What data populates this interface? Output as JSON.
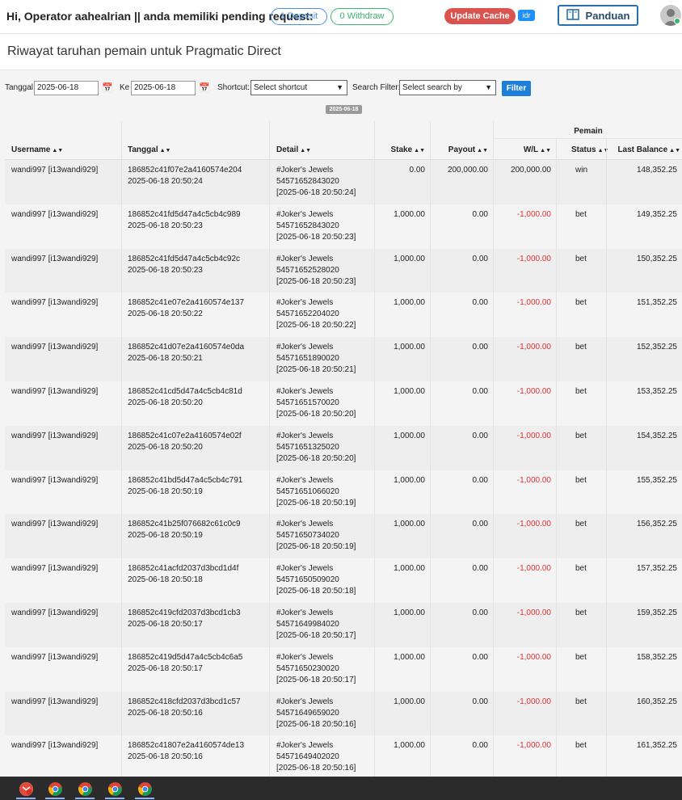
{
  "header": {
    "greeting": "Hi, Operator aahealrian || anda memiliki pending request:",
    "deposit_label": "1 Deposit",
    "withdraw_label": "0 Withdraw",
    "update_cache_label": "Update Cache",
    "currency_badge": "idr",
    "panduan_label": "Panduan",
    "avatar_icon": "user-avatar-icon"
  },
  "page": {
    "title": "Riwayat taruhan pemain untuk Pragmatic Direct"
  },
  "filters": {
    "tanggal_label": "Tanggal",
    "tanggal_value": "2025-06-18",
    "ke_label": "Ke",
    "ke_value": "2025-06-18",
    "shortcut_label": "Shortcut:",
    "shortcut_value": "Select shortcut",
    "search_filter_label": "Search Filter:",
    "search_filter_value": "Select search by",
    "filter_button": "Filter",
    "date_chip": "2025-06-18"
  },
  "table": {
    "group_header": "Pemain",
    "columns": [
      "Username",
      "Tanggal",
      "Detail",
      "Stake",
      "Payout",
      "W/L",
      "Status",
      "Last Balance"
    ],
    "rows": [
      {
        "username": "wandi997 [i13wandi929]",
        "id": "186852c41f07e2a4160574e204",
        "date": "2025-06-18 20:50:24",
        "game": "#Joker's Jewels",
        "round": "54571652843020",
        "ts": "[2025-06-18 20:50:24]",
        "stake": "0.00",
        "payout": "200,000.00",
        "wl": "200,000.00",
        "status": "win",
        "balance": "148,352.25"
      },
      {
        "username": "wandi997 [i13wandi929]",
        "id": "186852c41fd5d47a4c5cb4c989",
        "date": "2025-06-18 20:50:23",
        "game": "#Joker's Jewels",
        "round": "54571652843020",
        "ts": "[2025-06-18 20:50:23]",
        "stake": "1,000.00",
        "payout": "0.00",
        "wl": "-1,000.00",
        "status": "bet",
        "balance": "149,352.25"
      },
      {
        "username": "wandi997 [i13wandi929]",
        "id": "186852c41fd5d47a4c5cb4c92c",
        "date": "2025-06-18 20:50:23",
        "game": "#Joker's Jewels",
        "round": "54571652528020",
        "ts": "[2025-06-18 20:50:23]",
        "stake": "1,000.00",
        "payout": "0.00",
        "wl": "-1,000.00",
        "status": "bet",
        "balance": "150,352.25"
      },
      {
        "username": "wandi997 [i13wandi929]",
        "id": "186852c41e07e2a4160574e137",
        "date": "2025-06-18 20:50:22",
        "game": "#Joker's Jewels",
        "round": "54571652204020",
        "ts": "[2025-06-18 20:50:22]",
        "stake": "1,000.00",
        "payout": "0.00",
        "wl": "-1,000.00",
        "status": "bet",
        "balance": "151,352.25"
      },
      {
        "username": "wandi997 [i13wandi929]",
        "id": "186852c41d07e2a4160574e0da",
        "date": "2025-06-18 20:50:21",
        "game": "#Joker's Jewels",
        "round": "54571651890020",
        "ts": "[2025-06-18 20:50:21]",
        "stake": "1,000.00",
        "payout": "0.00",
        "wl": "-1,000.00",
        "status": "bet",
        "balance": "152,352.25"
      },
      {
        "username": "wandi997 [i13wandi929]",
        "id": "186852c41cd5d47a4c5cb4c81d",
        "date": "2025-06-18 20:50:20",
        "game": "#Joker's Jewels",
        "round": "54571651570020",
        "ts": "[2025-06-18 20:50:20]",
        "stake": "1,000.00",
        "payout": "0.00",
        "wl": "-1,000.00",
        "status": "bet",
        "balance": "153,352.25"
      },
      {
        "username": "wandi997 [i13wandi929]",
        "id": "186852c41c07e2a4160574e02f",
        "date": "2025-06-18 20:50:20",
        "game": "#Joker's Jewels",
        "round": "54571651325020",
        "ts": "[2025-06-18 20:50:20]",
        "stake": "1,000.00",
        "payout": "0.00",
        "wl": "-1,000.00",
        "status": "bet",
        "balance": "154,352.25"
      },
      {
        "username": "wandi997 [i13wandi929]",
        "id": "186852c41bd5d47a4c5cb4c791",
        "date": "2025-06-18 20:50:19",
        "game": "#Joker's Jewels",
        "round": "54571651066020",
        "ts": "[2025-06-18 20:50:19]",
        "stake": "1,000.00",
        "payout": "0.00",
        "wl": "-1,000.00",
        "status": "bet",
        "balance": "155,352.25"
      },
      {
        "username": "wandi997 [i13wandi929]",
        "id": "186852c41b25f076682c61c0c9",
        "date": "2025-06-18 20:50:19",
        "game": "#Joker's Jewels",
        "round": "54571650734020",
        "ts": "[2025-06-18 20:50:19]",
        "stake": "1,000.00",
        "payout": "0.00",
        "wl": "-1,000.00",
        "status": "bet",
        "balance": "156,352.25"
      },
      {
        "username": "wandi997 [i13wandi929]",
        "id": "186852c41acfd2037d3bcd1d4f",
        "date": "2025-06-18 20:50:18",
        "game": "#Joker's Jewels",
        "round": "54571650509020",
        "ts": "[2025-06-18 20:50:18]",
        "stake": "1,000.00",
        "payout": "0.00",
        "wl": "-1,000.00",
        "status": "bet",
        "balance": "157,352.25"
      },
      {
        "username": "wandi997 [i13wandi929]",
        "id": "186852c419cfd2037d3bcd1cb3",
        "date": "2025-06-18 20:50:17",
        "game": "#Joker's Jewels",
        "round": "54571649984020",
        "ts": "[2025-06-18 20:50:17]",
        "stake": "1,000.00",
        "payout": "0.00",
        "wl": "-1,000.00",
        "status": "bet",
        "balance": "159,352.25"
      },
      {
        "username": "wandi997 [i13wandi929]",
        "id": "186852c419d5d47a4c5cb4c6a5",
        "date": "2025-06-18 20:50:17",
        "game": "#Joker's Jewels",
        "round": "54571650230020",
        "ts": "[2025-06-18 20:50:17]",
        "stake": "1,000.00",
        "payout": "0.00",
        "wl": "-1,000.00",
        "status": "bet",
        "balance": "158,352.25"
      },
      {
        "username": "wandi997 [i13wandi929]",
        "id": "186852c418cfd2037d3bcd1c57",
        "date": "2025-06-18 20:50:16",
        "game": "#Joker's Jewels",
        "round": "54571649659020",
        "ts": "[2025-06-18 20:50:16]",
        "stake": "1,000.00",
        "payout": "0.00",
        "wl": "-1,000.00",
        "status": "bet",
        "balance": "160,352.25"
      },
      {
        "username": "wandi997 [i13wandi929]",
        "id": "186852c41807e2a4160574de13",
        "date": "2025-06-18 20:50:16",
        "game": "#Joker's Jewels",
        "round": "54571649402020",
        "ts": "[2025-06-18 20:50:16]",
        "stake": "1,000.00",
        "payout": "0.00",
        "wl": "-1,000.00",
        "status": "bet",
        "balance": "161,352.25"
      }
    ]
  },
  "colors": {
    "negative": "#e03131",
    "accent": "#1e7fd8",
    "cache_button": "#d9534f"
  },
  "taskbar": {
    "icons": [
      "gmail-icon",
      "chrome-icon",
      "chrome-icon",
      "chrome-icon",
      "chrome-icon"
    ]
  }
}
